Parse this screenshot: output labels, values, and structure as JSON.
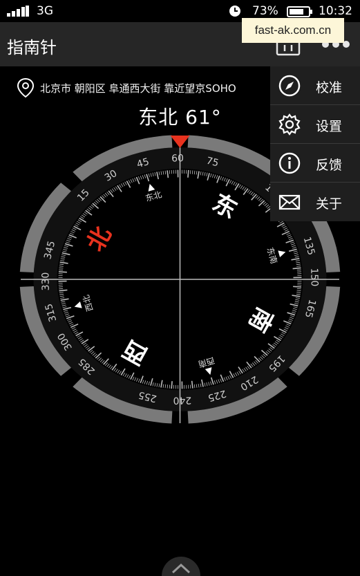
{
  "status_bar": {
    "network": "3G",
    "battery_percent": "73%",
    "time": "10:32"
  },
  "app_bar": {
    "title": "指南针",
    "watermark": "fast-ak.com.cn"
  },
  "location": {
    "text": "北京市 朝阳区 阜通西大街 靠近望京SOHO"
  },
  "heading": {
    "direction": "东北",
    "degrees": "61°"
  },
  "compass": {
    "bearing_deg": 61,
    "tick_labels": [
      "15",
      "30",
      "45",
      "60",
      "75",
      "105",
      "135",
      "150",
      "165",
      "195",
      "210",
      "225",
      "240",
      "255",
      "285",
      "300",
      "315",
      "330",
      "345"
    ],
    "cardinals": {
      "north": "北",
      "east": "东",
      "south": "南",
      "west": "西"
    },
    "intercardinals": {
      "northeast": "东北",
      "southeast": "东南",
      "southwest": "西南",
      "northwest": "西北"
    },
    "colors": {
      "north": "#e8321e",
      "pointer": "#e8321e",
      "ring": "#7a7a7a"
    }
  },
  "menu": {
    "items": [
      {
        "label": "校准",
        "icon": "compass-icon"
      },
      {
        "label": "设置",
        "icon": "gear-icon"
      },
      {
        "label": "反馈",
        "icon": "info-icon"
      },
      {
        "label": "关于",
        "icon": "mail-icon"
      }
    ]
  }
}
